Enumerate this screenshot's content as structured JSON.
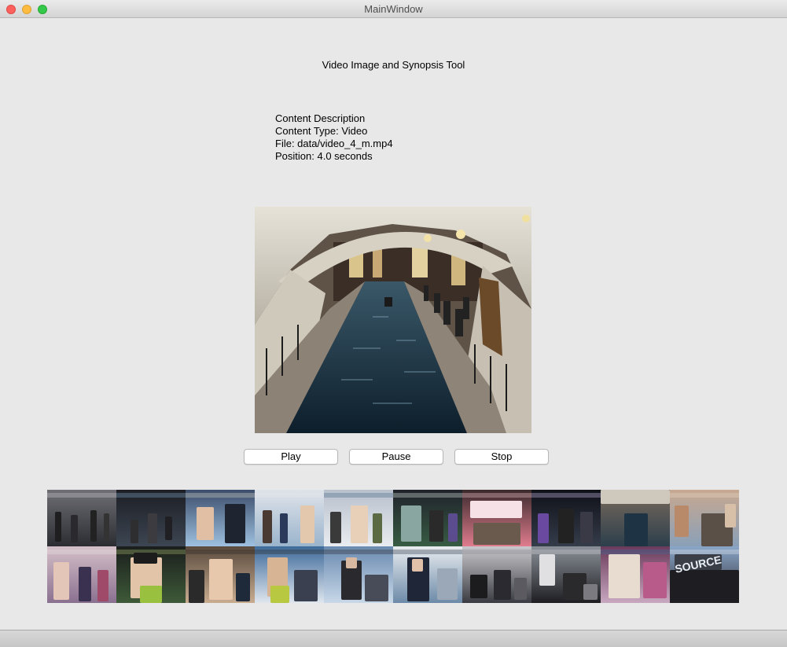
{
  "window": {
    "title": "MainWindow"
  },
  "app": {
    "title": "Video Image and Synopsis Tool"
  },
  "description": {
    "heading": "Content Description",
    "type": "Content Type: Video",
    "file": "File: data/video_4_m.mp4",
    "position": "Position: 4.0 seconds"
  },
  "controls": {
    "play": "Play",
    "pause": "Pause",
    "stop": "Stop"
  },
  "thumbnails": {
    "count": 20,
    "overlay_text": "SOURCE"
  },
  "colors": {
    "close": "#fc615d",
    "minimize": "#fdbc40",
    "maximize": "#34c84a",
    "window_bg": "#e8e8e8"
  }
}
